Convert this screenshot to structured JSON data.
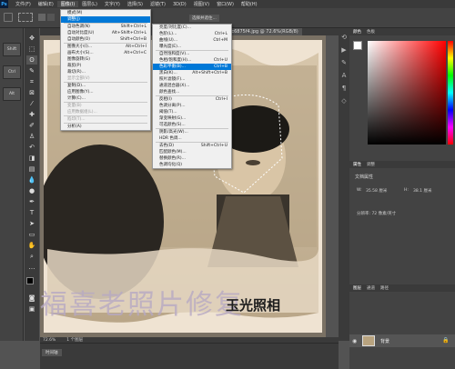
{
  "menubar": {
    "logo": "Ps",
    "items": [
      "文件(F)",
      "编辑(E)",
      "图像(I)",
      "图层(L)",
      "文字(Y)",
      "选择(S)",
      "滤镜(T)",
      "3D(D)",
      "视图(V)",
      "窗口(W)",
      "帮助(H)"
    ]
  },
  "doc_tab": {
    "title": "文件名称.jpg @ 72.6%(RGB/8)",
    "title_right": "8bc6875f4.jpg @ 72.6%(RGB/8)",
    "extra": "选择并遮住..."
  },
  "left_keys": [
    "Shift",
    "Ctrl",
    "Alt"
  ],
  "image_menu": {
    "items": [
      {
        "label": "模式(M)",
        "shortcut": ""
      },
      {
        "label": "调整(J)",
        "shortcut": "",
        "highlight": true
      },
      {
        "sep": true
      },
      {
        "label": "自动色调(N)",
        "shortcut": "Shift+Ctrl+L"
      },
      {
        "label": "自动对比度(U)",
        "shortcut": "Alt+Shift+Ctrl+L"
      },
      {
        "label": "自动颜色(O)",
        "shortcut": "Shift+Ctrl+B"
      },
      {
        "sep": true
      },
      {
        "label": "图像大小(I)...",
        "shortcut": "Alt+Ctrl+I"
      },
      {
        "label": "画布大小(S)...",
        "shortcut": "Alt+Ctrl+C"
      },
      {
        "label": "图像旋转(G)",
        "shortcut": ""
      },
      {
        "label": "裁剪(P)",
        "shortcut": ""
      },
      {
        "label": "裁切(R)...",
        "shortcut": ""
      },
      {
        "label": "显示全部(V)",
        "shortcut": "",
        "disabled": true
      },
      {
        "sep": true
      },
      {
        "label": "复制(D)...",
        "shortcut": ""
      },
      {
        "label": "应用图像(Y)...",
        "shortcut": ""
      },
      {
        "label": "计算(C)...",
        "shortcut": ""
      },
      {
        "sep": true
      },
      {
        "label": "变量(B)",
        "shortcut": "",
        "disabled": true
      },
      {
        "label": "应用数据组(L)...",
        "shortcut": "",
        "disabled": true
      },
      {
        "sep": true
      },
      {
        "label": "陷印(T)...",
        "shortcut": "",
        "disabled": true
      },
      {
        "sep": true
      },
      {
        "label": "分析(A)",
        "shortcut": ""
      }
    ]
  },
  "adjust_menu": {
    "items": [
      {
        "label": "亮度/对比度(C)...",
        "shortcut": ""
      },
      {
        "label": "色阶(L)...",
        "shortcut": "Ctrl+L"
      },
      {
        "label": "曲线(U)...",
        "shortcut": "Ctrl+M"
      },
      {
        "label": "曝光度(E)...",
        "shortcut": ""
      },
      {
        "sep": true
      },
      {
        "label": "自然饱和度(V)...",
        "shortcut": ""
      },
      {
        "label": "色相/饱和度(H)...",
        "shortcut": "Ctrl+U"
      },
      {
        "label": "色彩平衡(B)...",
        "shortcut": "Ctrl+B",
        "highlight": true
      },
      {
        "label": "黑白(K)...",
        "shortcut": "Alt+Shift+Ctrl+B"
      },
      {
        "label": "照片滤镜(F)...",
        "shortcut": ""
      },
      {
        "label": "通道混合器(X)...",
        "shortcut": ""
      },
      {
        "label": "颜色查找...",
        "shortcut": ""
      },
      {
        "sep": true
      },
      {
        "label": "反相(I)",
        "shortcut": "Ctrl+I"
      },
      {
        "label": "色调分离(P)...",
        "shortcut": ""
      },
      {
        "label": "阈值(T)...",
        "shortcut": ""
      },
      {
        "label": "渐变映射(G)...",
        "shortcut": ""
      },
      {
        "label": "可选颜色(S)...",
        "shortcut": ""
      },
      {
        "sep": true
      },
      {
        "label": "阴影/高光(W)...",
        "shortcut": ""
      },
      {
        "label": "HDR 色调...",
        "shortcut": ""
      },
      {
        "sep": true
      },
      {
        "label": "去色(D)",
        "shortcut": "Shift+Ctrl+U"
      },
      {
        "label": "匹配颜色(M)...",
        "shortcut": ""
      },
      {
        "label": "替换颜色(R)...",
        "shortcut": ""
      },
      {
        "label": "色调均化(Q)",
        "shortcut": ""
      }
    ]
  },
  "panels": {
    "color_tabs": [
      "颜色",
      "色板"
    ],
    "properties_tabs": [
      "属性",
      "调整"
    ],
    "properties_title": "文档属性",
    "w_label": "W:",
    "w_value": "35.58 厘米",
    "h_label": "H:",
    "h_value": "38.1 厘米",
    "resolution": "分辨率: 72 像素/英寸",
    "layers_tabs": [
      "图层",
      "通道",
      "路径"
    ],
    "layer_name": "背景"
  },
  "status": {
    "zoom": "72.6%",
    "info": "1 个图层"
  },
  "timeline_label": "时间轴",
  "watermark": "福喜老照片修复",
  "stamp_text": "玉光照相",
  "colors": {
    "highlight": "#0078d7",
    "ui_dark": "#3a3a3a",
    "ui_mid": "#434343"
  }
}
